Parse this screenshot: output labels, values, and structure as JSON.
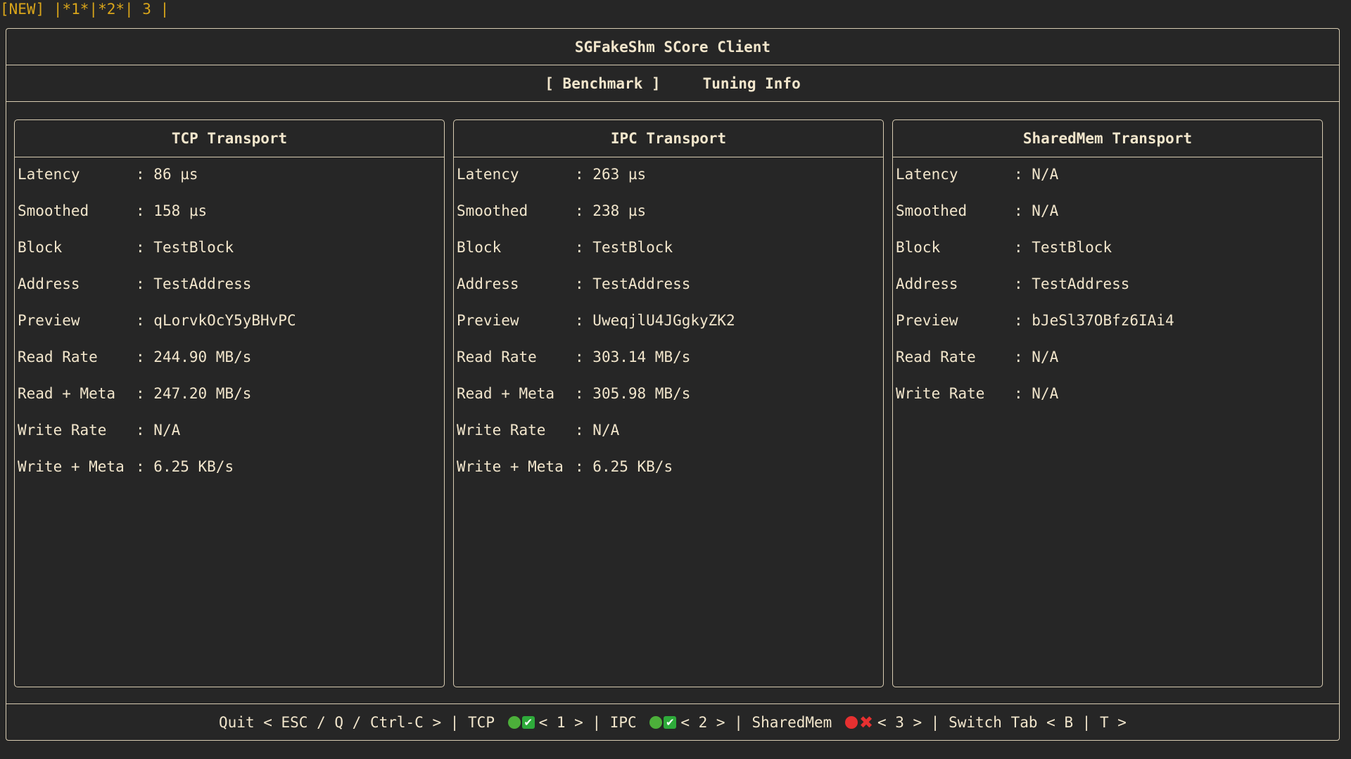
{
  "colors": {
    "background": "#262626",
    "foreground": "#f2e6cc",
    "tabline": "#d9a51a",
    "border": "#d8ccb2",
    "status_ok": "#4caf3a",
    "status_ok_check": "#2eaa3a",
    "status_err": "#e63030"
  },
  "tabline": {
    "text": "[NEW] |*1*|*2*| 3 |"
  },
  "header": {
    "title": "SGFakeShm SCore Client"
  },
  "tabs": [
    {
      "label": "[ Benchmark ]",
      "active": true
    },
    {
      "label": "Tuning Info",
      "active": false
    }
  ],
  "panels": [
    {
      "title": "TCP Transport",
      "rows": [
        {
          "label": "Latency",
          "value": "86 µs"
        },
        {
          "label": "Smoothed",
          "value": "158 µs"
        },
        {
          "label": "Block",
          "value": "TestBlock"
        },
        {
          "label": "Address",
          "value": "TestAddress"
        },
        {
          "label": "Preview",
          "value": "qLorvkOcY5yBHvPC"
        },
        {
          "label": "Read Rate",
          "value": "244.90 MB/s"
        },
        {
          "label": "Read + Meta",
          "value": "247.20 MB/s"
        },
        {
          "label": "Write Rate",
          "value": "N/A"
        },
        {
          "label": "Write + Meta",
          "value": "6.25 KB/s"
        }
      ]
    },
    {
      "title": "IPC Transport",
      "rows": [
        {
          "label": "Latency",
          "value": "263 µs"
        },
        {
          "label": "Smoothed",
          "value": "238 µs"
        },
        {
          "label": "Block",
          "value": "TestBlock"
        },
        {
          "label": "Address",
          "value": "TestAddress"
        },
        {
          "label": "Preview",
          "value": "UweqjlU4JGgkyZK2"
        },
        {
          "label": "Read Rate",
          "value": "303.14 MB/s"
        },
        {
          "label": "Read + Meta",
          "value": "305.98 MB/s"
        },
        {
          "label": "Write Rate",
          "value": "N/A"
        },
        {
          "label": "Write + Meta",
          "value": "6.25 KB/s"
        }
      ]
    },
    {
      "title": "SharedMem Transport",
      "rows": [
        {
          "label": "Latency",
          "value": "N/A"
        },
        {
          "label": "Smoothed",
          "value": "N/A"
        },
        {
          "label": "Block",
          "value": "TestBlock"
        },
        {
          "label": "Address",
          "value": "TestAddress"
        },
        {
          "label": "Preview",
          "value": "bJeSl37OBfz6IAi4"
        },
        {
          "label": "Read Rate",
          "value": "N/A"
        },
        {
          "label": "Write Rate",
          "value": "N/A"
        }
      ]
    }
  ],
  "footer": {
    "quit": "Quit < ESC / Q / Ctrl-C > | ",
    "tcp_label": "TCP ",
    "tcp_status": "ok",
    "tcp_key": "< 1 > | ",
    "ipc_label": "IPC ",
    "ipc_status": "ok",
    "ipc_key": "< 2 > | ",
    "sharedmem_label": "SharedMem ",
    "sharedmem_status": "error",
    "sharedmem_key": "< 3 > | ",
    "switch_tab": "Switch Tab < B | T >"
  },
  "separator": ": "
}
